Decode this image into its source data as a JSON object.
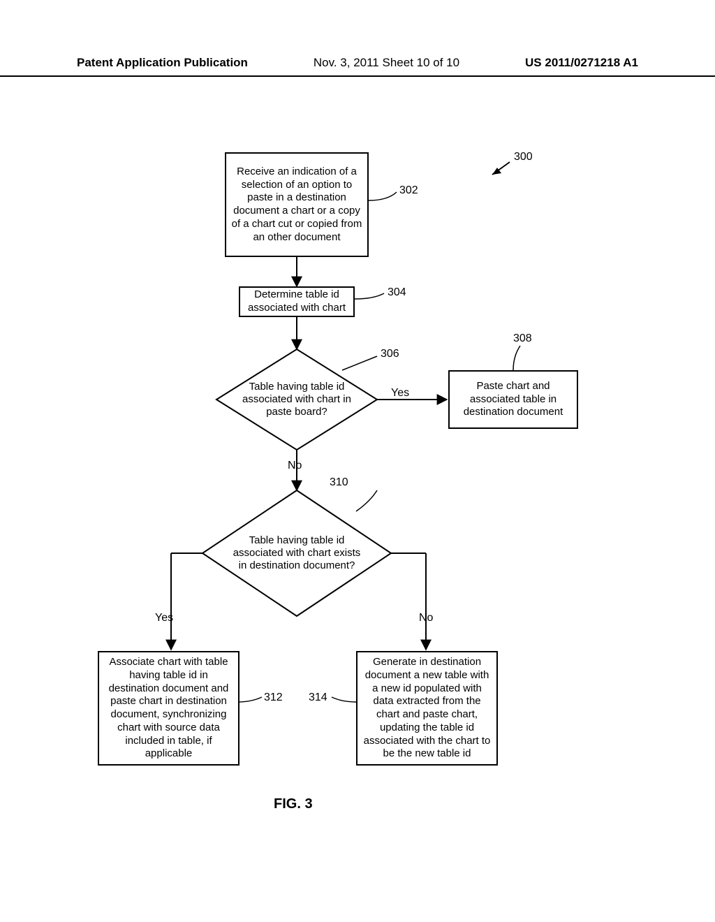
{
  "header": {
    "left": "Patent Application Publication",
    "mid": "Nov. 3, 2011   Sheet 10 of 10",
    "right": "US 2011/0271218 A1"
  },
  "figure": {
    "title": "FIG. 3",
    "overall_ref": "300"
  },
  "steps": {
    "s302": {
      "ref": "302",
      "text": "Receive an indication of a selection of an option to paste in a destination document a chart or a copy of a chart cut or copied from an other document"
    },
    "s304": {
      "ref": "304",
      "text": "Determine table id associated with chart"
    },
    "s306": {
      "ref": "306",
      "text": "Table having table id associated with chart in paste board?"
    },
    "s308": {
      "ref": "308",
      "text": "Paste chart and associated table in destination document"
    },
    "s310": {
      "ref": "310",
      "text": "Table having table id associated with chart exists in destination document?"
    },
    "s312": {
      "ref": "312",
      "text": "Associate chart with table having table id in destination document and paste chart in destination document, synchronizing chart with source data included in table, if applicable"
    },
    "s314": {
      "ref": "314",
      "text": "Generate in destination document a new table with a new id populated with data extracted from the chart and paste chart, updating the table id associated with the chart to be the new table id"
    }
  },
  "branch_labels": {
    "yes1": "Yes",
    "no1": "No",
    "yes2": "Yes",
    "no2": "No"
  }
}
